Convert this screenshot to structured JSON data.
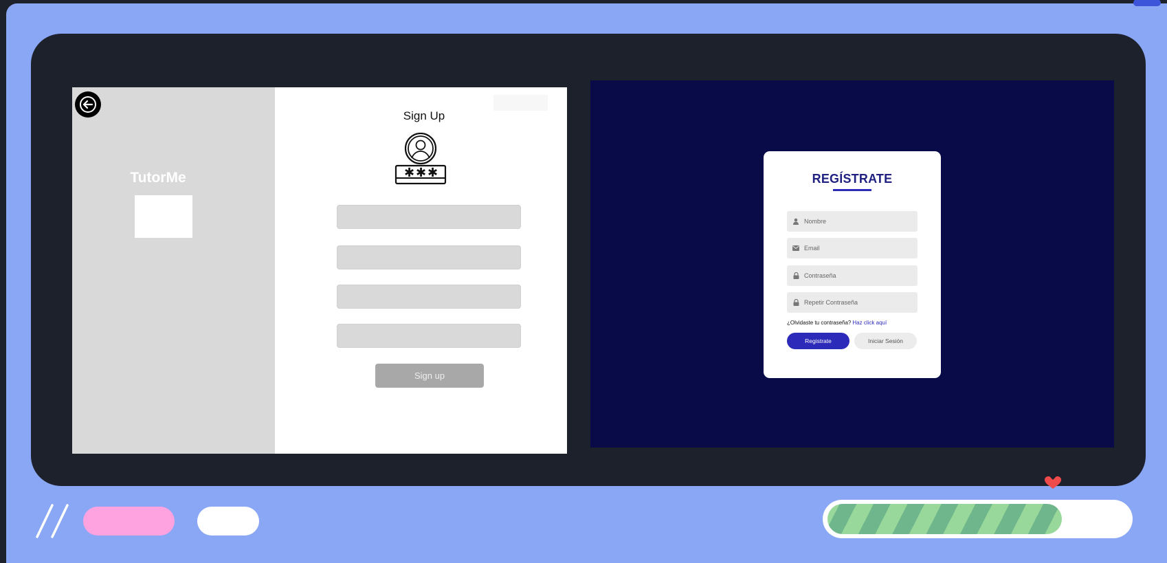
{
  "wireframe": {
    "brand": "TutorMe",
    "title": "Sign Up",
    "input_count": 4,
    "submit_label": "Sign up",
    "icons": {
      "back": "arrow-left-icon",
      "account": "user-password-icon"
    }
  },
  "design": {
    "title": "REGÍSTRATE",
    "fields": [
      {
        "placeholder": "Nombre",
        "icon": "user-icon"
      },
      {
        "placeholder": "Email",
        "icon": "envelope-icon"
      },
      {
        "placeholder": "Contraseña",
        "icon": "lock-icon"
      },
      {
        "placeholder": "Repetir Contraseña",
        "icon": "lock-icon"
      }
    ],
    "forgot_text": "¿Olvidaste tu contraseña?",
    "forgot_link": "Haz click aquí",
    "register_label": "Registrate",
    "login_label": "Iniciar Sesión"
  },
  "toolbar": {
    "progress": 0.78,
    "colors": {
      "frame": "#8aa7f5",
      "stage": "#1d212b",
      "design_bg": "#090b48",
      "accent": "#2c2ab8",
      "pink": "#ffa3e0",
      "progress": "#98d99b",
      "heart": "#ef4b4b"
    },
    "icons": {
      "marker": "heart-icon",
      "logo": "double-slash-icon"
    }
  }
}
